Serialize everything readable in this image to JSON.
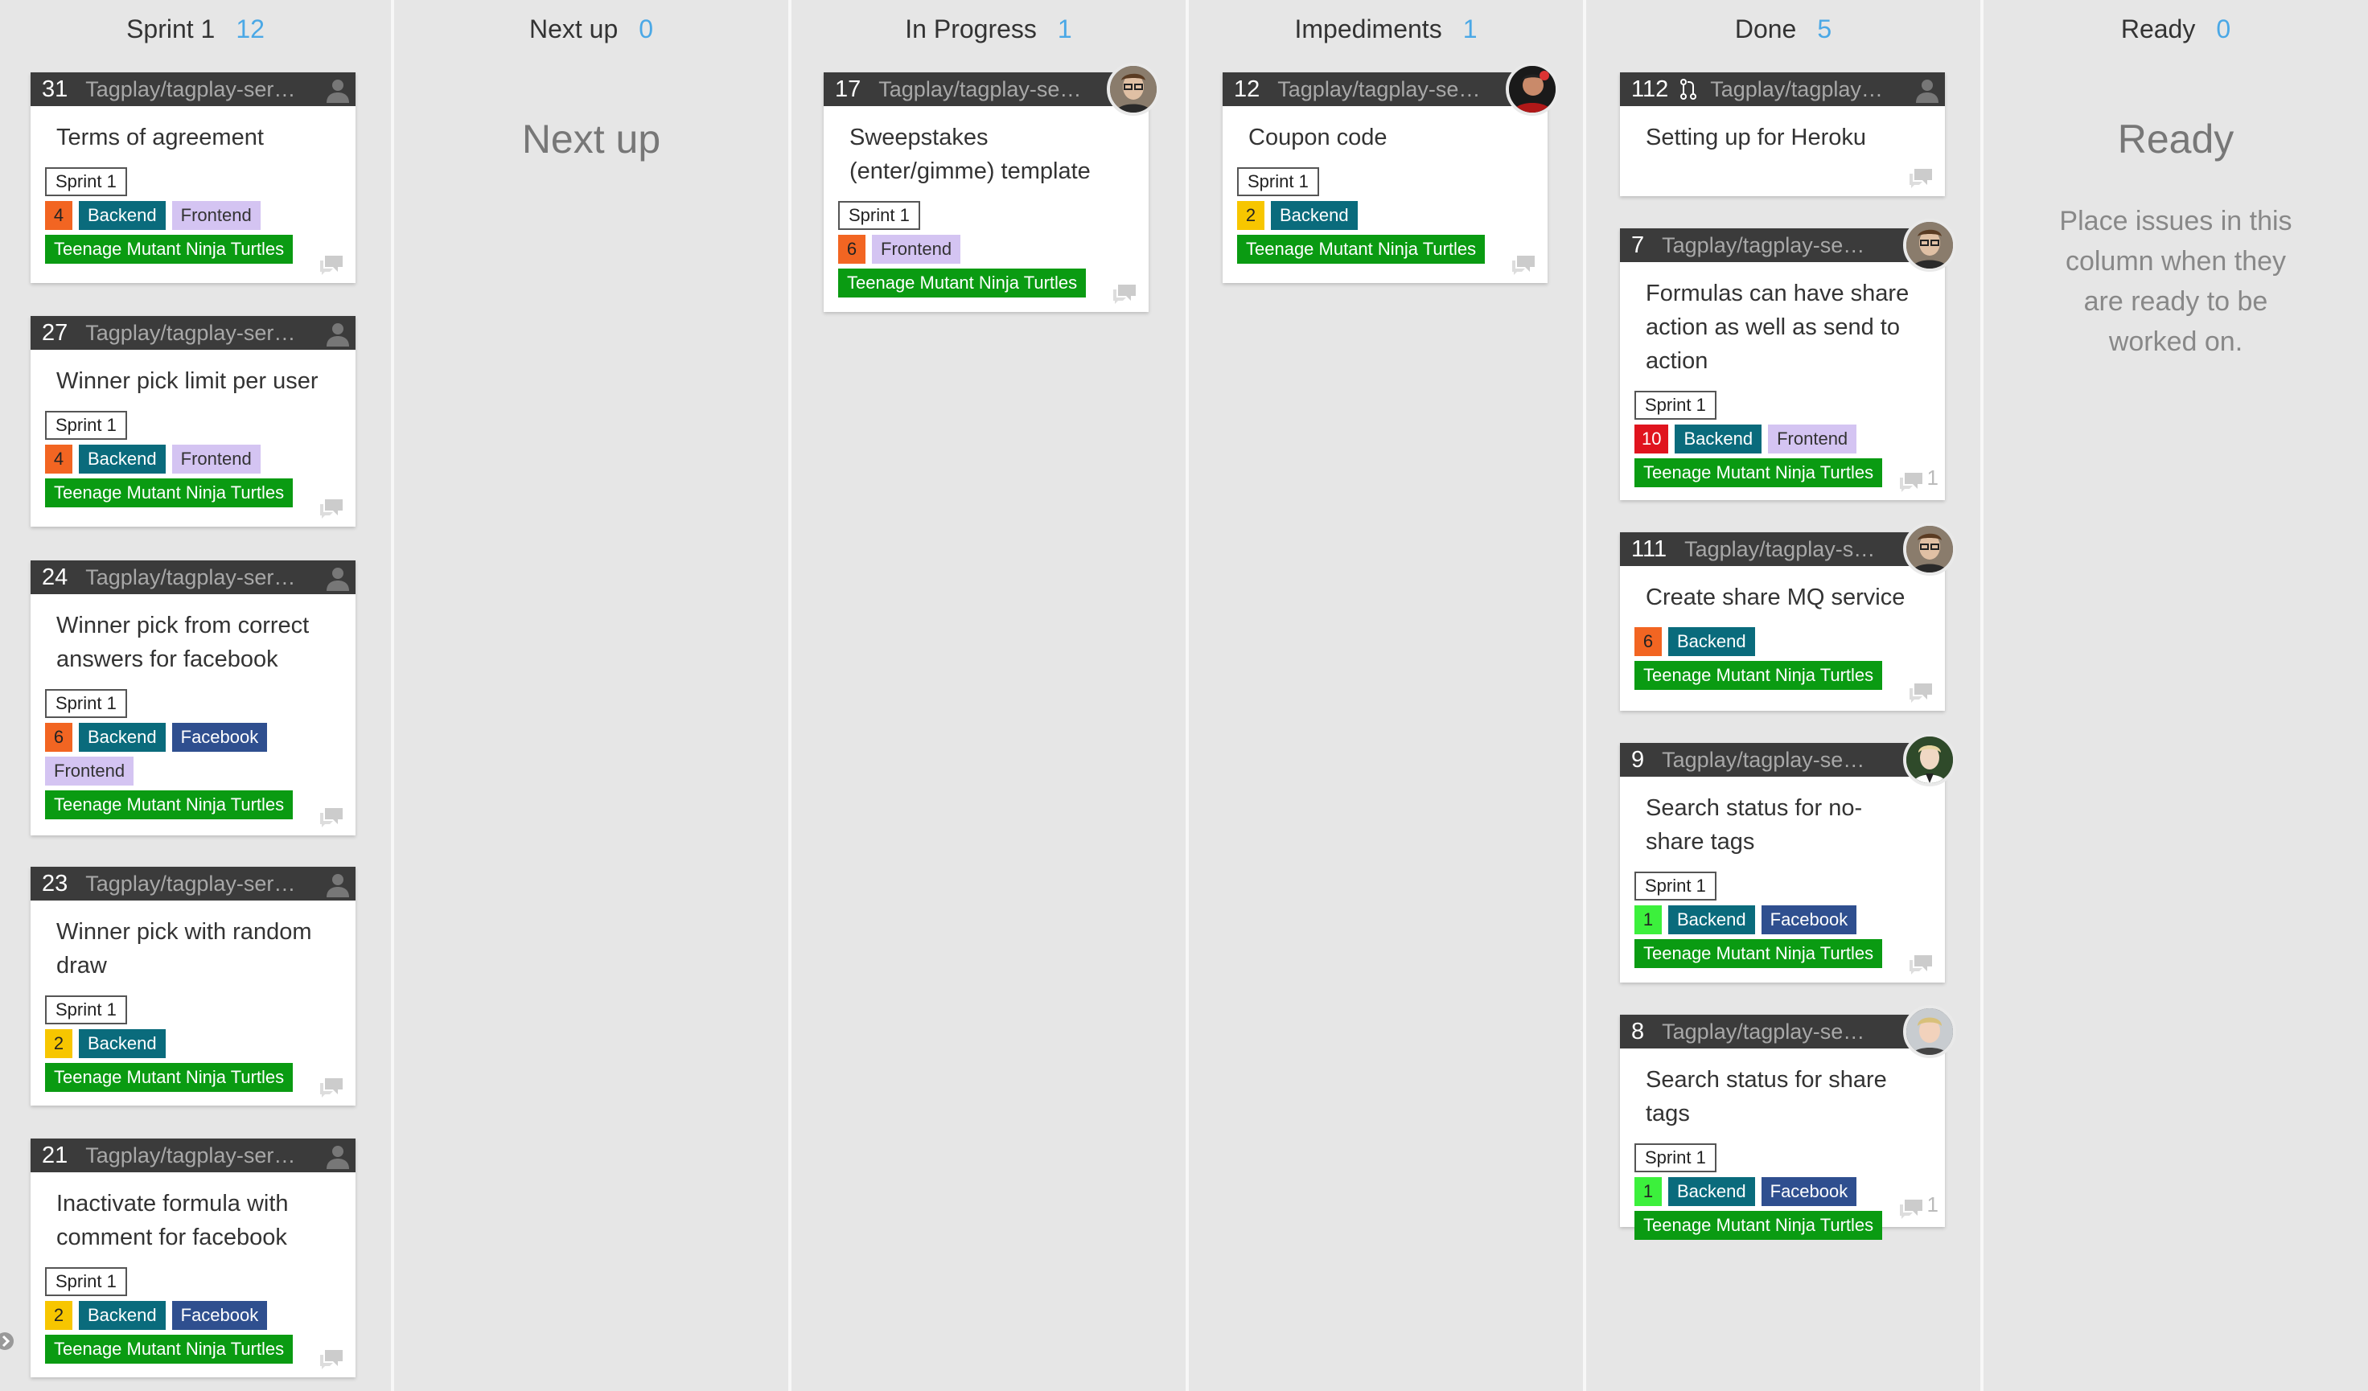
{
  "columns": [
    {
      "id": "sprint1",
      "title": "Sprint 1",
      "count": "12"
    },
    {
      "id": "nextup",
      "title": "Next up",
      "count": "0",
      "placeholder_title": "Next up"
    },
    {
      "id": "inprogress",
      "title": "In Progress",
      "count": "1"
    },
    {
      "id": "impediments",
      "title": "Impediments",
      "count": "1"
    },
    {
      "id": "done",
      "title": "Done",
      "count": "5"
    },
    {
      "id": "ready",
      "title": "Ready",
      "count": "0",
      "placeholder_title": "Ready",
      "placeholder_text": "Place issues in this column when they are ready to be worked on."
    }
  ],
  "colors": {
    "estimate_orange": "#f26522",
    "estimate_yellow": "#f7c600",
    "estimate_red": "#e0141e",
    "estimate_green": "#3cf03c",
    "backend": "#0a6b7c",
    "frontend": "#d4c4f2",
    "facebook": "#2f4f8f",
    "tmnt": "#0a9b12",
    "count_blue": "#4aa8e6"
  },
  "cards": {
    "c31": {
      "number": "31",
      "repo": "Tagplay/tagplay-service",
      "title": "Terms of agreement",
      "sprint": "Sprint 1",
      "estimate": "4",
      "labels": [
        "Backend",
        "Frontend"
      ],
      "milestone": "Teenage Mutant Ninja Turtles"
    },
    "c27": {
      "number": "27",
      "repo": "Tagplay/tagplay-service",
      "title": "Winner pick limit per user",
      "sprint": "Sprint 1",
      "estimate": "4",
      "labels": [
        "Backend",
        "Frontend"
      ],
      "milestone": "Teenage Mutant Ninja Turtles"
    },
    "c24": {
      "number": "24",
      "repo": "Tagplay/tagplay-service",
      "title": "Winner pick from correct answers for facebook",
      "sprint": "Sprint 1",
      "estimate": "6",
      "labels": [
        "Backend",
        "Facebook",
        "Frontend"
      ],
      "milestone": "Teenage Mutant Ninja Turtles"
    },
    "c23": {
      "number": "23",
      "repo": "Tagplay/tagplay-service",
      "title": "Winner pick with random draw",
      "sprint": "Sprint 1",
      "estimate": "2",
      "labels": [
        "Backend"
      ],
      "milestone": "Teenage Mutant Ninja Turtles"
    },
    "c21": {
      "number": "21",
      "repo": "Tagplay/tagplay-service",
      "title": "Inactivate formula with comment for facebook",
      "sprint": "Sprint 1",
      "estimate": "2",
      "labels": [
        "Backend",
        "Facebook"
      ],
      "milestone": "Teenage Mutant Ninja Turtles"
    },
    "c17": {
      "number": "17",
      "repo": "Tagplay/tagplay-service",
      "title": "Sweepstakes (enter/gimme) template",
      "sprint": "Sprint 1",
      "estimate": "6",
      "labels": [
        "Frontend"
      ],
      "milestone": "Teenage Mutant Ninja Turtles"
    },
    "c12": {
      "number": "12",
      "repo": "Tagplay/tagplay-service",
      "title": "Coupon code",
      "sprint": "Sprint 1",
      "estimate": "2",
      "labels": [
        "Backend"
      ],
      "milestone": "Teenage Mutant Ninja Turtles"
    },
    "c112": {
      "number": "112",
      "repo": "Tagplay/tagplay-service",
      "title": "Setting up for Heroku"
    },
    "c7": {
      "number": "7",
      "repo": "Tagplay/tagplay-service",
      "title": "Formulas can have share action as well as send to action",
      "sprint": "Sprint 1",
      "estimate": "10",
      "labels": [
        "Backend",
        "Frontend"
      ],
      "milestone": "Teenage Mutant Ninja Turtles",
      "comments": "1"
    },
    "c111": {
      "number": "111",
      "repo": "Tagplay/tagplay-service",
      "title": "Create share MQ service",
      "estimate": "6",
      "labels": [
        "Backend"
      ],
      "milestone": "Teenage Mutant Ninja Turtles"
    },
    "c9": {
      "number": "9",
      "repo": "Tagplay/tagplay-service",
      "title": "Search status for no-share tags",
      "sprint": "Sprint 1",
      "estimate": "1",
      "labels": [
        "Backend",
        "Facebook"
      ],
      "milestone": "Teenage Mutant Ninja Turtles"
    },
    "c8": {
      "number": "8",
      "repo": "Tagplay/tagplay-service",
      "title": "Search status for share tags",
      "sprint": "Sprint 1",
      "estimate": "1",
      "labels": [
        "Backend",
        "Facebook"
      ],
      "milestone": "Teenage Mutant Ninja Turtles",
      "comments": "1"
    }
  }
}
